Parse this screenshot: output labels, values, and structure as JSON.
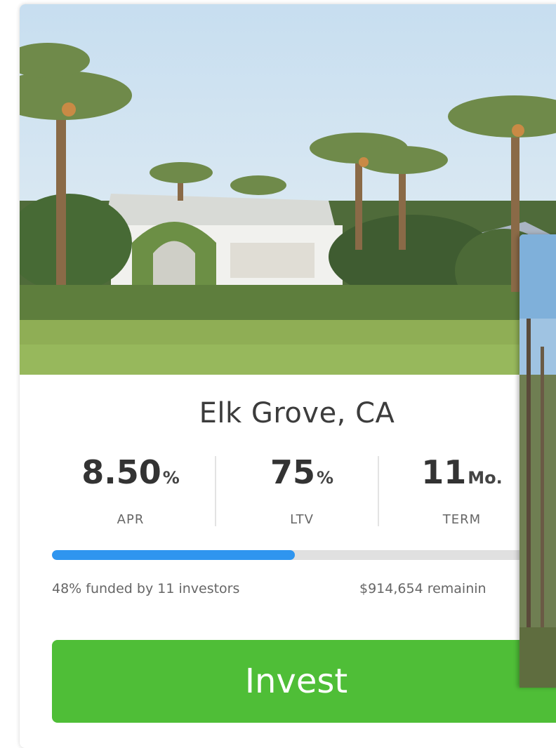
{
  "listing": {
    "location": "Elk Grove, CA",
    "stats": [
      {
        "value": "8.50",
        "unit": "%",
        "label": "APR"
      },
      {
        "value": "75",
        "unit": "%",
        "label": "LTV"
      },
      {
        "value": "11",
        "unit": "Mo.",
        "label": "TERM"
      }
    ],
    "funded_fraction": 0.48,
    "funded_text": "48% funded by 11 investors",
    "remaining_text": "$914,654 remainin",
    "invest_label": "Invest"
  },
  "colors": {
    "progress_fill": "#2f95ef",
    "invest_button": "#4fbe37"
  }
}
